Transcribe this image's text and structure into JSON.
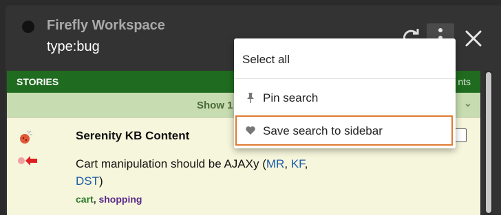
{
  "header": {
    "workspace_title": "Firefly Workspace",
    "search_term": "type:bug"
  },
  "stories_panel": {
    "header_label": "STORIES",
    "header_right": "nts",
    "show_bar_text": "Show 1"
  },
  "story": {
    "title": "Serenity KB Content",
    "description_text": "Cart manipulation should be AJAXy (",
    "owners": [
      {
        "label": "MR"
      },
      {
        "label": "KF"
      },
      {
        "label": "DST"
      }
    ],
    "description_end": ")",
    "tags": [
      {
        "label": "cart",
        "color": "#2b7a2b"
      },
      {
        "label": "shopping",
        "color": "#5a2a8a"
      }
    ]
  },
  "menu": {
    "items": [
      {
        "label": "Select all",
        "icon": "none"
      },
      {
        "label": "Pin search",
        "icon": "pin-icon"
      },
      {
        "label": "Save search to sidebar",
        "icon": "heart-icon"
      }
    ]
  },
  "colors": {
    "stories_header_bg": "#1f6b1f",
    "show_bar_bg": "#c7dcb0",
    "story_bg": "#f6f6dc",
    "highlight_border": "#e07a30",
    "link": "#1a5ba8"
  }
}
